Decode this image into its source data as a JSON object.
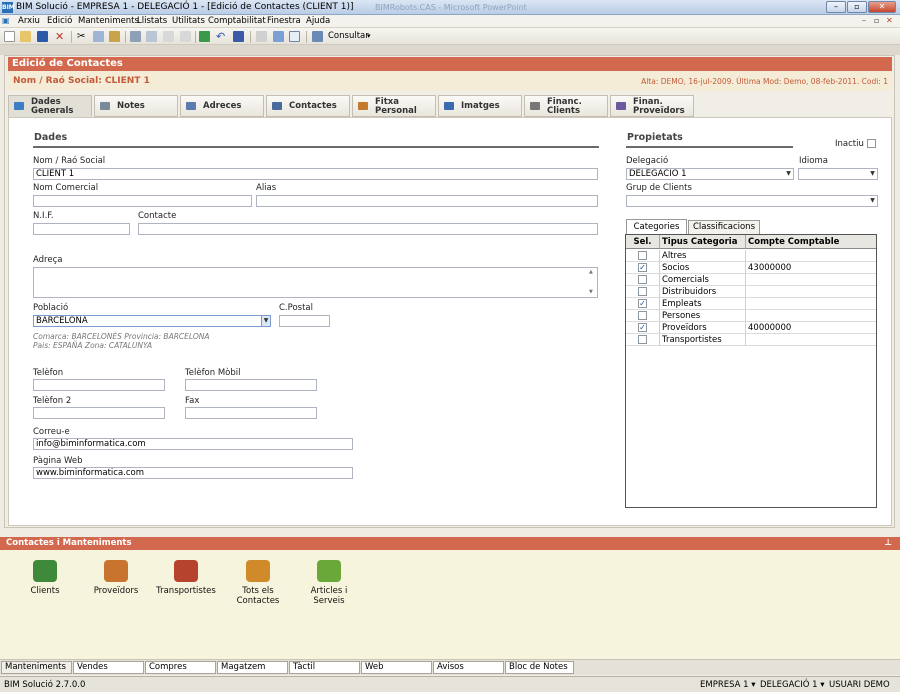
{
  "window": {
    "title": "BIM Solució - EMPRESA 1 - DELEGACIÓ 1 - [Edició de Contactes (CLIENT 1)]",
    "ghost_title": "BIMRobots.CAS - Microsoft PowerPoint",
    "app_icon": "BIM"
  },
  "menu": [
    "Arxiu",
    "Edició",
    "Manteniments",
    "Llistats",
    "Utilitats",
    "Comptabilitat",
    "Finestra",
    "Ajuda"
  ],
  "toolbar": {
    "consult_label": "Consultar"
  },
  "form": {
    "title": "Edició de Contactes",
    "contact_name": "Nom / Raó Social: CLIENT 1",
    "meta": "Alta: DEMO, 16-jul-2009. Última Mod: Demo, 08-feb-2011. Codi: 1"
  },
  "tabs": [
    {
      "label1": "Dades",
      "label2": "Generals",
      "color": "#3a7fc4"
    },
    {
      "label1": "Notes",
      "label2": "",
      "color": "#7a8a9a"
    },
    {
      "label1": "Adreces",
      "label2": "",
      "color": "#5a7ab0"
    },
    {
      "label1": "Contactes",
      "label2": "",
      "color": "#4a6a9a"
    },
    {
      "label1": "Fitxa",
      "label2": "Personal",
      "color": "#c47a2a"
    },
    {
      "label1": "Imatges",
      "label2": "",
      "color": "#3a6ab0"
    },
    {
      "label1": "Financ.",
      "label2": "Clients",
      "color": "#777777"
    },
    {
      "label1": "Finan.",
      "label2": "Proveïdors",
      "color": "#6a5aa0"
    }
  ],
  "dades": {
    "section_title": "Dades",
    "nom_label": "Nom / Raó Social",
    "nom_value": "CLIENT 1",
    "nom_comercial_label": "Nom Comercial",
    "nom_comercial_value": "",
    "alias_label": "Alias",
    "alias_value": "",
    "nif_label": "N.I.F.",
    "nif_value": "",
    "contacte_label": "Contacte",
    "contacte_value": "",
    "adreca_label": "Adreça",
    "adreca_value": "",
    "poblacio_label": "Població",
    "poblacio_value": "BARCELONA",
    "cpostal_label": "C.Postal",
    "cpostal_value": "",
    "comarca_info": "Comarca: BARCELONÈS Provincia: BARCELONA",
    "pais_info": "Pais: ESPAÑA Zona: CATALUNYA",
    "telefon_label": "Telèfon",
    "telefon_value": "",
    "mobil_label": "Telèfon Mòbil",
    "mobil_value": "",
    "telefon2_label": "Telèfon 2",
    "telefon2_value": "",
    "fax_label": "Fax",
    "fax_value": "",
    "correu_label": "Correu-e",
    "correu_value": "info@biminformatica.com",
    "web_label": "Pàgina Web",
    "web_value": "www.biminformatica.com"
  },
  "propietats": {
    "section_title": "Propietats",
    "inactiu_label": "Inactiu",
    "delegacio_label": "Delegació",
    "delegacio_value": "DELEGACIÓ 1",
    "idioma_label": "Idioma",
    "idioma_value": "",
    "grup_label": "Grup de Clients",
    "grup_value": ""
  },
  "subtabs": [
    "Categories",
    "Classificacions"
  ],
  "grid": {
    "headers": [
      "Sel.",
      "Tipus Categoria",
      "Compte Comptable"
    ],
    "rows": [
      {
        "checked": false,
        "tipus": "Altres",
        "compte": ""
      },
      {
        "checked": true,
        "tipus": "Socios",
        "compte": "43000000"
      },
      {
        "checked": false,
        "tipus": "Comercials",
        "compte": ""
      },
      {
        "checked": false,
        "tipus": "Distribuidors",
        "compte": ""
      },
      {
        "checked": true,
        "tipus": "Empleats",
        "compte": ""
      },
      {
        "checked": false,
        "tipus": "Persones",
        "compte": ""
      },
      {
        "checked": true,
        "tipus": "Proveïdors",
        "compte": "40000000"
      },
      {
        "checked": false,
        "tipus": "Transportistes",
        "compte": ""
      }
    ]
  },
  "contacts_panel": {
    "title": "Contactes i Manteniments",
    "pin_icon": "pin-icon",
    "shortcuts": [
      {
        "line1": "Clients",
        "line2": "",
        "color": "#3f8a3a"
      },
      {
        "line1": "Proveïdors",
        "line2": "",
        "color": "#c8742e"
      },
      {
        "line1": "Transportistes",
        "line2": "",
        "color": "#b5432e"
      },
      {
        "line1": "Tots els",
        "line2": "Contactes",
        "color": "#d08a2a"
      },
      {
        "line1": "Articles i",
        "line2": "Serveis",
        "color": "#6aa83a"
      }
    ]
  },
  "bottom_tabs": [
    "Manteniments",
    "Vendes",
    "Compres",
    "Magatzem",
    "Tàctil",
    "Web",
    "Avisos",
    "Bloc de Notes"
  ],
  "status": {
    "version": "BIM Solució 2.7.0.0",
    "empresa": "EMPRESA 1 ▾",
    "delegacio": "DELEGACIÓ 1 ▾",
    "usuari": "USUARI DEMO"
  }
}
